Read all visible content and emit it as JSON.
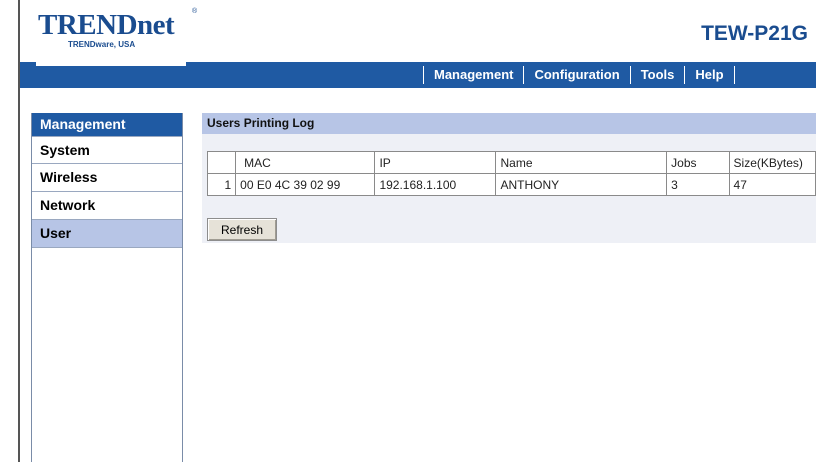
{
  "header": {
    "logo_text": "TRENDnet",
    "logo_reg": "®",
    "logo_subtitle": "TRENDware, USA",
    "model": "TEW-P21G"
  },
  "nav": {
    "items": [
      {
        "label": "Management"
      },
      {
        "label": "Configuration"
      },
      {
        "label": "Tools"
      },
      {
        "label": "Help"
      }
    ]
  },
  "sidebar": {
    "header": "Management",
    "items": [
      {
        "label": "System"
      },
      {
        "label": "Wireless"
      },
      {
        "label": "Network"
      },
      {
        "label": "User",
        "active": true
      }
    ]
  },
  "main": {
    "title": "Users Printing Log",
    "table": {
      "columns": [
        "",
        "MAC",
        "IP",
        "Name",
        "Jobs",
        "Size(KBytes)"
      ],
      "rows": [
        [
          "1",
          "00 E0 4C 39 02 99",
          "192.168.1.100",
          "ANTHONY",
          "3",
          "47"
        ]
      ]
    },
    "refresh_label": "Refresh"
  },
  "colors": {
    "brand_blue": "#1f5aa3",
    "logo_blue": "#1a4c8f",
    "panel_header": "#b7c5e6",
    "panel_bg": "#eef0f6"
  }
}
